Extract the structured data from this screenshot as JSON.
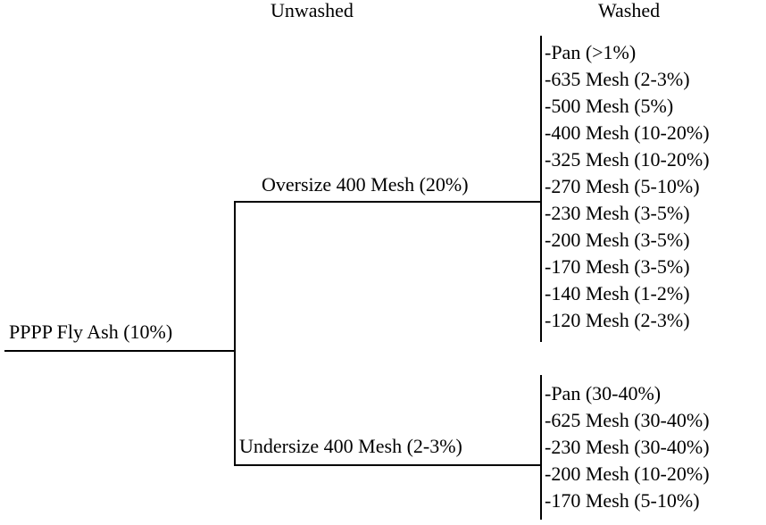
{
  "headers": {
    "unwashed": "Unwashed",
    "washed": "Washed"
  },
  "root": {
    "label": "PPPP Fly Ash (10%)"
  },
  "branches": {
    "oversize": {
      "label": "Oversize 400 Mesh (20%)",
      "fractions": [
        "-Pan (>1%)",
        "-635 Mesh (2-3%)",
        "-500 Mesh (5%)",
        "-400 Mesh (10-20%)",
        "-325 Mesh (10-20%)",
        "-270 Mesh (5-10%)",
        "-230 Mesh (3-5%)",
        "-200 Mesh (3-5%)",
        "-170 Mesh (3-5%)",
        "-140 Mesh (1-2%)",
        "-120 Mesh (2-3%)"
      ]
    },
    "undersize": {
      "label": "Undersize 400 Mesh (2-3%)",
      "fractions": [
        "-Pan (30-40%)",
        "-625 Mesh (30-40%)",
        "-230 Mesh (30-40%)",
        "-200 Mesh (10-20%)",
        "-170 Mesh (5-10%)"
      ]
    }
  }
}
